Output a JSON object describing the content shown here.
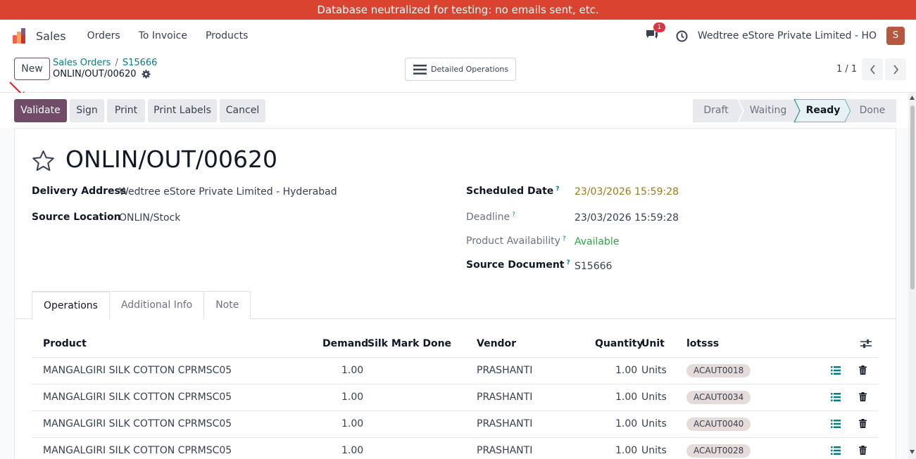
{
  "banner": "Database neutralized for testing: no emails sent, etc.",
  "navbar": {
    "app_name": "Sales",
    "menu": [
      "Orders",
      "To Invoice",
      "Products"
    ],
    "notification_count": "1",
    "company": "Wedtree eStore Private Limited - HO",
    "avatar_initial": "S"
  },
  "control": {
    "new_label": "New",
    "breadcrumb": [
      "Sales Orders",
      "S15666"
    ],
    "record_name": "ONLIN/OUT/00620",
    "detailed_ops_label": "Detailed Operations",
    "pager": "1 / 1"
  },
  "actions": {
    "validate": "Validate",
    "sign": "Sign",
    "print": "Print",
    "print_labels": "Print Labels",
    "cancel": "Cancel"
  },
  "status_stages": [
    "Draft",
    "Waiting",
    "Ready",
    "Done"
  ],
  "active_stage": "Ready",
  "form": {
    "title": "ONLIN/OUT/00620",
    "delivery_address_label": "Delivery Address",
    "delivery_address": "Wedtree eStore Private Limited - Hyderabad",
    "source_location_label": "Source Location",
    "source_location": "ONLIN/Stock",
    "scheduled_date_label": "Scheduled Date",
    "scheduled_date": "23/03/2026 15:59:28",
    "deadline_label": "Deadline",
    "deadline": "23/03/2026 15:59:28",
    "availability_label": "Product Availability",
    "availability": "Available",
    "source_document_label": "Source Document",
    "source_document": "S15666",
    "help_mark": "?"
  },
  "tabs": [
    "Operations",
    "Additional Info",
    "Note"
  ],
  "table": {
    "headers": {
      "product": "Product",
      "demand": "Demand",
      "silk_mark": "Silk Mark Done",
      "vendor": "Vendor",
      "quantity": "Quantity",
      "unit": "Unit",
      "lots": "lotsss"
    },
    "rows": [
      {
        "product": "MANGALGIRI SILK COTTON CPRMSC05",
        "demand": "1.00",
        "vendor": "PRASHANTI",
        "quantity": "1.00",
        "unit": "Units",
        "lot": "ACAUT0018"
      },
      {
        "product": "MANGALGIRI SILK COTTON CPRMSC05",
        "demand": "1.00",
        "vendor": "PRASHANTI",
        "quantity": "1.00",
        "unit": "Units",
        "lot": "ACAUT0034"
      },
      {
        "product": "MANGALGIRI SILK COTTON CPRMSC05",
        "demand": "1.00",
        "vendor": "PRASHANTI",
        "quantity": "1.00",
        "unit": "Units",
        "lot": "ACAUT0040"
      },
      {
        "product": "MANGALGIRI SILK COTTON CPRMSC05",
        "demand": "1.00",
        "vendor": "PRASHANTI",
        "quantity": "1.00",
        "unit": "Units",
        "lot": "ACAUT0028"
      }
    ]
  },
  "colors": {
    "banner": "#d9432f",
    "primary": "#714b67",
    "link": "#017e84",
    "scheduled_date": "#a1781d",
    "available": "#28a745"
  }
}
